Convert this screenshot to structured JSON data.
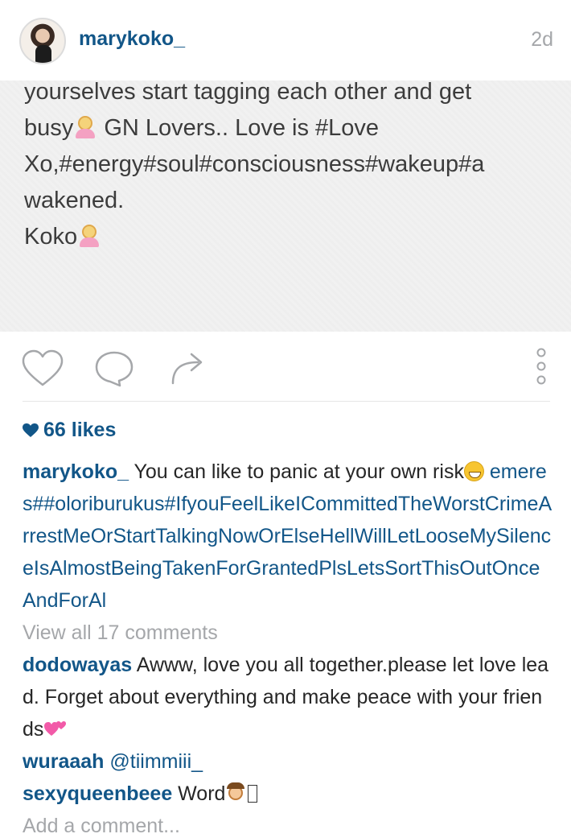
{
  "post": {
    "username": "marykoko_",
    "time": "2d",
    "image_text": {
      "line1": "yourselves start tagging each other and get",
      "line2_a": "busy",
      "line2_b": " GN Lovers.. Love is #Love",
      "line3": "Xo,#energy#soul#consciousness#wakeup#a",
      "line4": "wakened.",
      "line5": "Koko"
    }
  },
  "actions": {
    "like_icon": "heart-outline-icon",
    "comment_icon": "speech-bubble-icon",
    "share_icon": "share-arrow-icon",
    "more_icon": "vertical-dots-icon"
  },
  "likes": {
    "icon": "heart-filled-icon",
    "text": "66 likes"
  },
  "caption": {
    "username": "marykoko_",
    "text": " You can like to panic at your own risk",
    "tags": "emeres##oloriburukus#IfyouFeelLikeICommittedTheWorstCrimeArrestMeOrStartTalkingNowOrElseHellWillLetLooseMySilenceIsAlmostBeingTakenForGrantedPlsLetsSortThisOutOnceAndForAl"
  },
  "view_all": "View all 17 comments",
  "comments": [
    {
      "username": "dodowayas",
      "text": " Awww, love you all together.please let love lead. Forget about everything and make peace with your friends"
    },
    {
      "username": "wuraaah",
      "text": " @tiimmiii_"
    },
    {
      "username": "sexyqueenbeee",
      "text": " Word"
    }
  ],
  "add_comment": "Add a comment...",
  "colors": {
    "link": "#125688",
    "muted": "#a5a7aa",
    "text": "#262626"
  }
}
